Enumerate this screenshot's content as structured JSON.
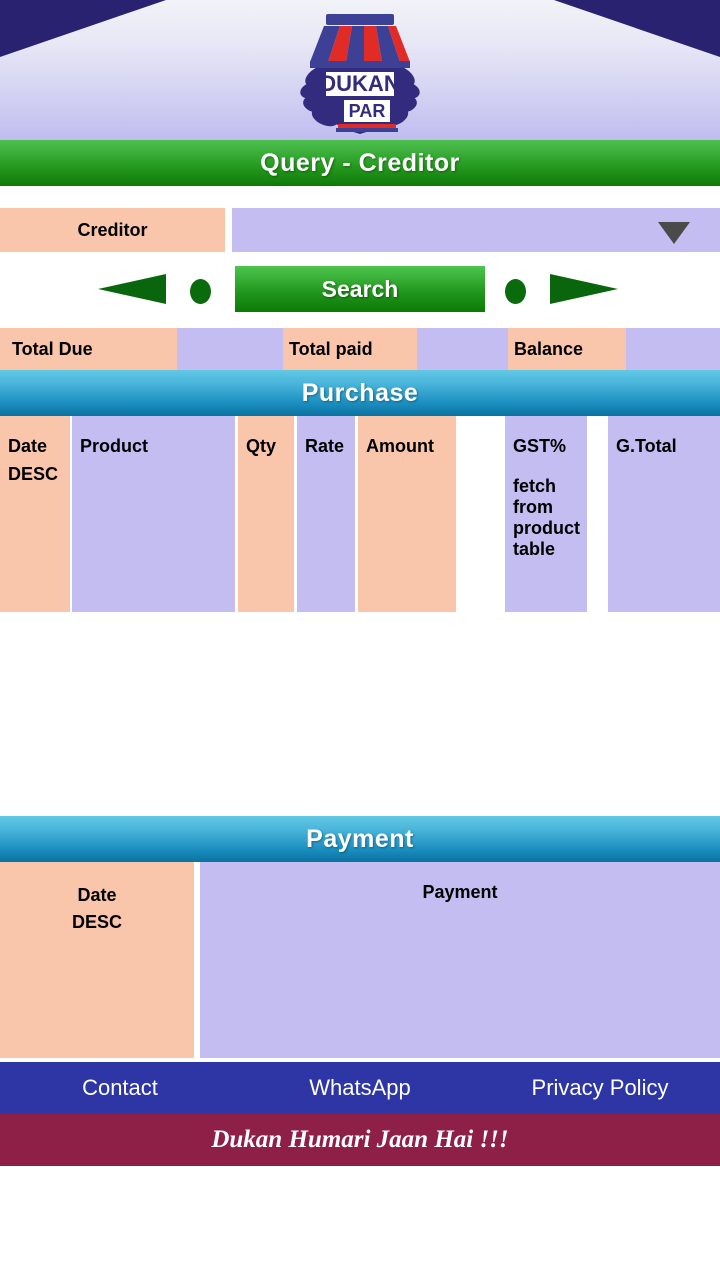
{
  "app": {
    "logo_text_top": "DUKAN",
    "logo_text_bottom": "PAR"
  },
  "header": {
    "title": "Query - Creditor"
  },
  "query_form": {
    "creditor_label": "Creditor",
    "creditor_value": "",
    "creditor_placeholder": "",
    "dropdown_icon": "chevron-down-icon",
    "prev_icon": "triangle-left-icon",
    "prev_dot_icon": "dot-icon",
    "search_label": "Search",
    "next_dot_icon": "dot-icon",
    "next_icon": "triangle-right-icon"
  },
  "totals": {
    "total_due_label": "Total Due",
    "total_due_value": "",
    "total_paid_label": "Total paid",
    "total_paid_value": "",
    "balance_label": "Balance",
    "balance_value": ""
  },
  "purchase": {
    "banner": "Purchase",
    "columns": [
      {
        "label": "Date",
        "sublabel": "DESC"
      },
      {
        "label": "Product",
        "sublabel": ""
      },
      {
        "label": "Qty",
        "sublabel": ""
      },
      {
        "label": "Rate",
        "sublabel": ""
      },
      {
        "label": "Amount",
        "sublabel": ""
      },
      {
        "label": "GST%",
        "sublabel": "fetch from product table"
      },
      {
        "label": "G.Total",
        "sublabel": ""
      }
    ],
    "rows": []
  },
  "payment": {
    "banner": "Payment",
    "date_label": "Date",
    "date_sublabel": "DESC",
    "payment_label": "Payment",
    "rows": []
  },
  "footer": {
    "links": [
      {
        "label": "Contact"
      },
      {
        "label": "WhatsApp"
      },
      {
        "label": "Privacy Policy"
      }
    ],
    "tagline": "Dukan Humari Jaan Hai !!!"
  },
  "colors": {
    "brand_navy": "#282270",
    "brand_red": "#e02b26",
    "banner_green": "#25991f",
    "banner_blue": "#1b8fc0",
    "peach": "#fac6ab",
    "lavender": "#c3bdf2",
    "footer_blue": "#2e36a5",
    "footer_maroon": "#8e2048"
  }
}
